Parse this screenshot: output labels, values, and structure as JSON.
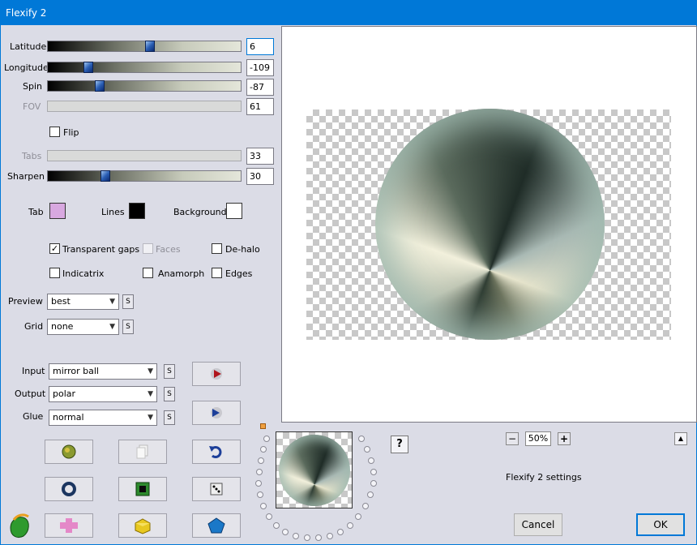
{
  "window": {
    "title": "Flexify 2"
  },
  "sliders": {
    "latitude": {
      "label": "Latitude",
      "value": "6",
      "fraction": 0.53
    },
    "longitude": {
      "label": "Longitude",
      "value": "-109",
      "fraction": 0.2
    },
    "spin": {
      "label": "Spin",
      "value": "-87",
      "fraction": 0.26
    },
    "fov": {
      "label": "FOV",
      "value": "61"
    },
    "tabs": {
      "label": "Tabs",
      "value": "33"
    },
    "sharpen": {
      "label": "Sharpen",
      "value": "30",
      "fraction": 0.3
    }
  },
  "flip": {
    "label": "Flip",
    "checked": false
  },
  "colors": {
    "tab": {
      "label": "Tab",
      "color": "#d8a8e0"
    },
    "lines": {
      "label": "Lines",
      "color": "#000000"
    },
    "background": {
      "label": "Background",
      "color": "#ffffff"
    }
  },
  "options": {
    "transparent_gaps": {
      "label": "Transparent gaps",
      "checked": true
    },
    "faces": {
      "label": "Faces",
      "checked": false
    },
    "de_halo": {
      "label": "De-halo",
      "checked": false
    },
    "indicatrix": {
      "label": "Indicatrix",
      "checked": false
    },
    "anamorph": {
      "label": "Anamorph",
      "checked": false
    },
    "edges": {
      "label": "Edges",
      "checked": false
    }
  },
  "preview": {
    "label": "Preview",
    "value": "best"
  },
  "grid": {
    "label": "Grid",
    "value": "none"
  },
  "input": {
    "label": "Input",
    "value": "mirror ball"
  },
  "output": {
    "label": "Output",
    "value": "polar"
  },
  "glue": {
    "label": "Glue",
    "value": "normal"
  },
  "s_label": "S",
  "check_mark": "✓",
  "help_label": "?",
  "zoom": {
    "minus": "−",
    "value": "50%",
    "plus": "+"
  },
  "collapse_label": "▲",
  "settings_text": "Flexify 2 settings",
  "buttons": {
    "cancel": "Cancel",
    "ok": "OK"
  },
  "theme": {
    "accent": "#0078d7",
    "panel": "#dbdce6"
  }
}
